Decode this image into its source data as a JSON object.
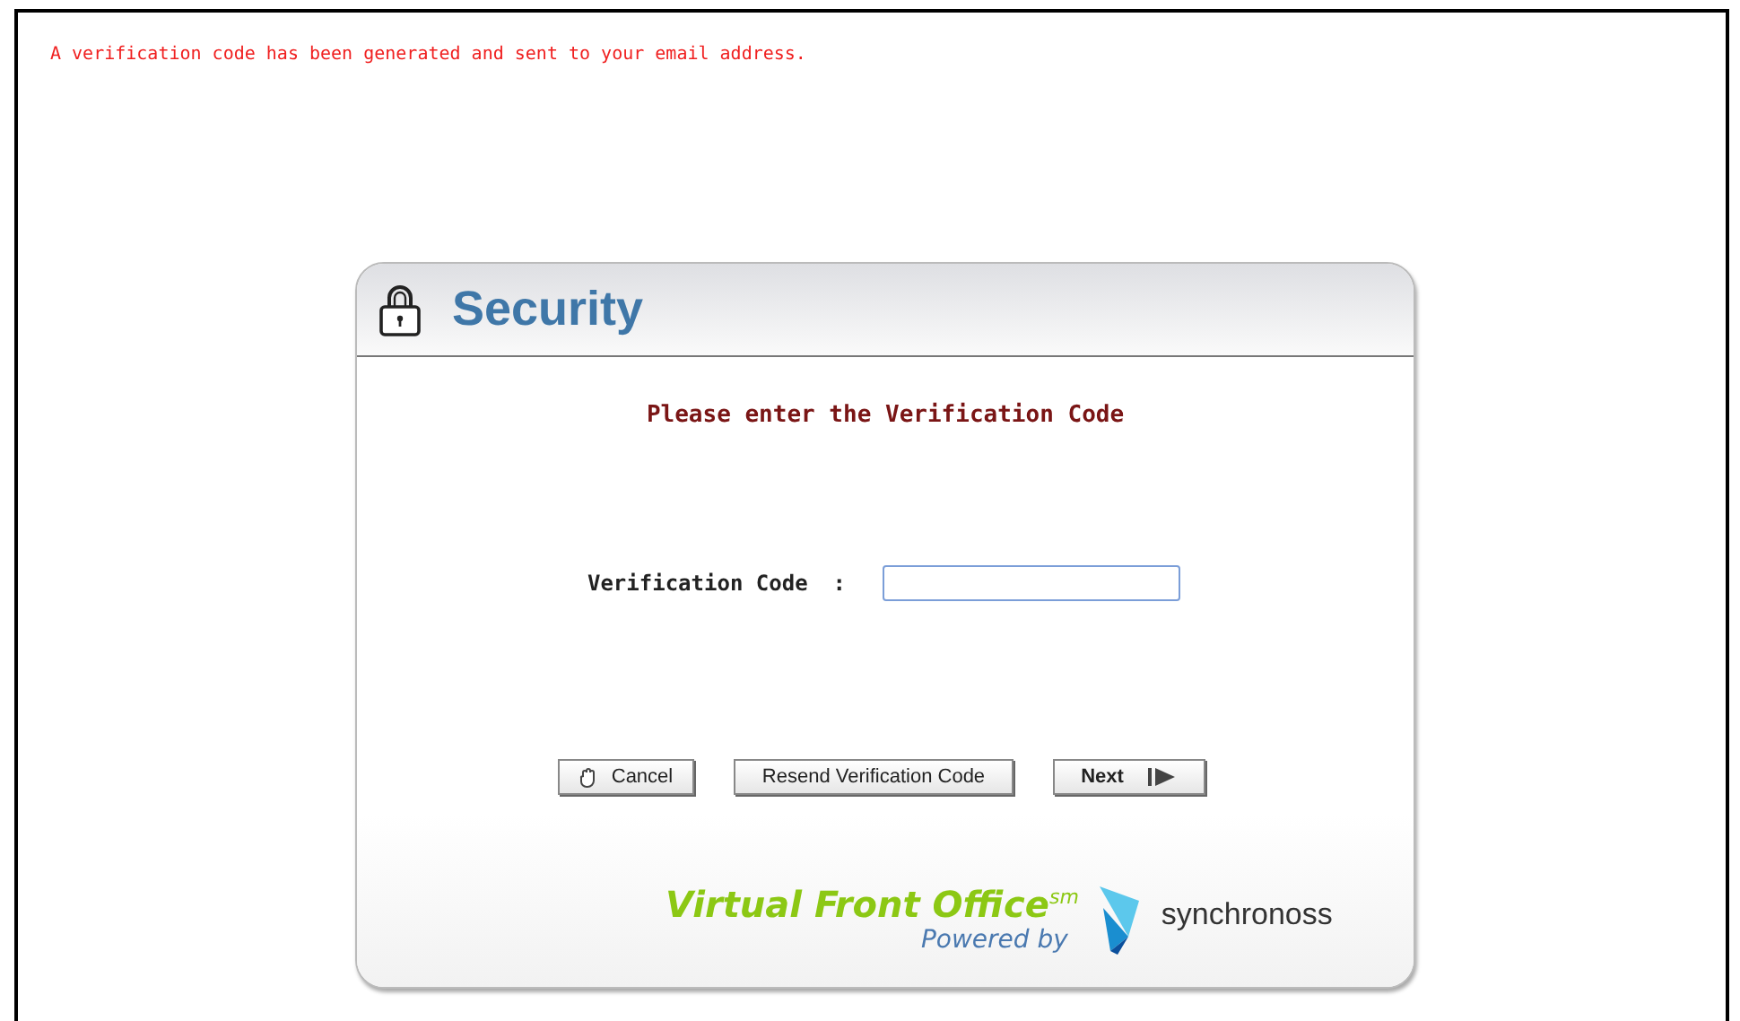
{
  "notice": "A verification code has been generated and sent to your email address.",
  "card": {
    "title": "Security",
    "prompt": "Please enter the Verification Code",
    "field": {
      "label": "Verification Code",
      "separator": ":"
    },
    "buttons": [
      {
        "label": "Cancel",
        "kind": "cancel"
      },
      {
        "label": "Resend Verification Code",
        "kind": "plain"
      },
      {
        "label": "Next",
        "kind": "next"
      }
    ],
    "footer": {
      "product": "Virtual Front Office$^{sm}$",
      "powered_by": "Powered by",
      "logo_text": "synchronoss"
    }
  }
}
